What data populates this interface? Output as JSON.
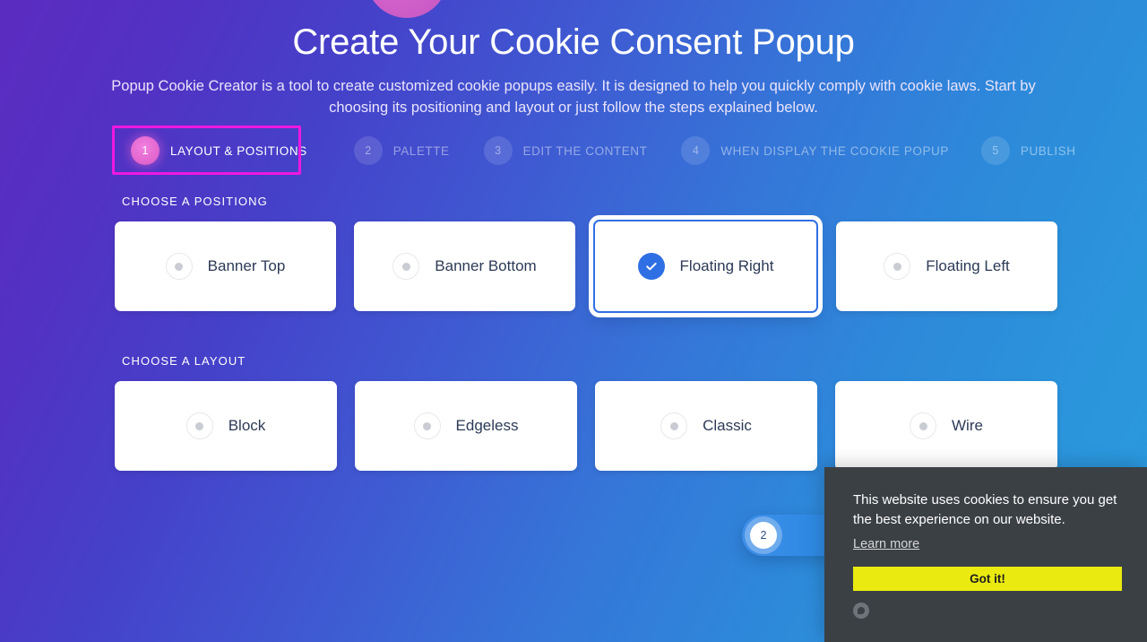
{
  "header": {
    "title": "Create Your Cookie Consent Popup",
    "subtitle": "Popup Cookie Creator is a tool to create customized cookie popups easily. It is designed to help you quickly comply with cookie laws. Start by choosing its positioning and layout or just follow the steps explained below."
  },
  "steps": [
    {
      "number": "1",
      "label": "LAYOUT & POSITIONS",
      "active": true
    },
    {
      "number": "2",
      "label": "PALETTE",
      "active": false
    },
    {
      "number": "3",
      "label": "EDIT THE CONTENT",
      "active": false
    },
    {
      "number": "4",
      "label": "WHEN DISPLAY THE COOKIE POPUP",
      "active": false
    },
    {
      "number": "5",
      "label": "PUBLISH",
      "active": false
    }
  ],
  "positioning": {
    "label": "CHOOSE A POSITIONG",
    "options": [
      {
        "label": "Banner Top",
        "selected": false
      },
      {
        "label": "Banner Bottom",
        "selected": false
      },
      {
        "label": "Floating Right",
        "selected": true
      },
      {
        "label": "Floating Left",
        "selected": false
      }
    ]
  },
  "layout": {
    "label": "CHOOSE A LAYOUT",
    "options": [
      {
        "label": "Block",
        "selected": false
      },
      {
        "label": "Edgeless",
        "selected": false
      },
      {
        "label": "Classic",
        "selected": false
      },
      {
        "label": "Wire",
        "selected": false
      }
    ]
  },
  "floating_pill": {
    "number": "2"
  },
  "cookie_popup": {
    "message": "This website uses cookies to ensure you get the best experience on our website.",
    "link_label": "Learn more",
    "button_label": "Got it!"
  },
  "colors": {
    "gradient_start": "#5b2cc0",
    "gradient_end": "#2a9ade",
    "highlight": "#ef18e0",
    "accent_blue": "#2f6fe4",
    "step_active": "#e368cf",
    "popup_bg": "#3b4045",
    "popup_button": "#eaea11"
  }
}
